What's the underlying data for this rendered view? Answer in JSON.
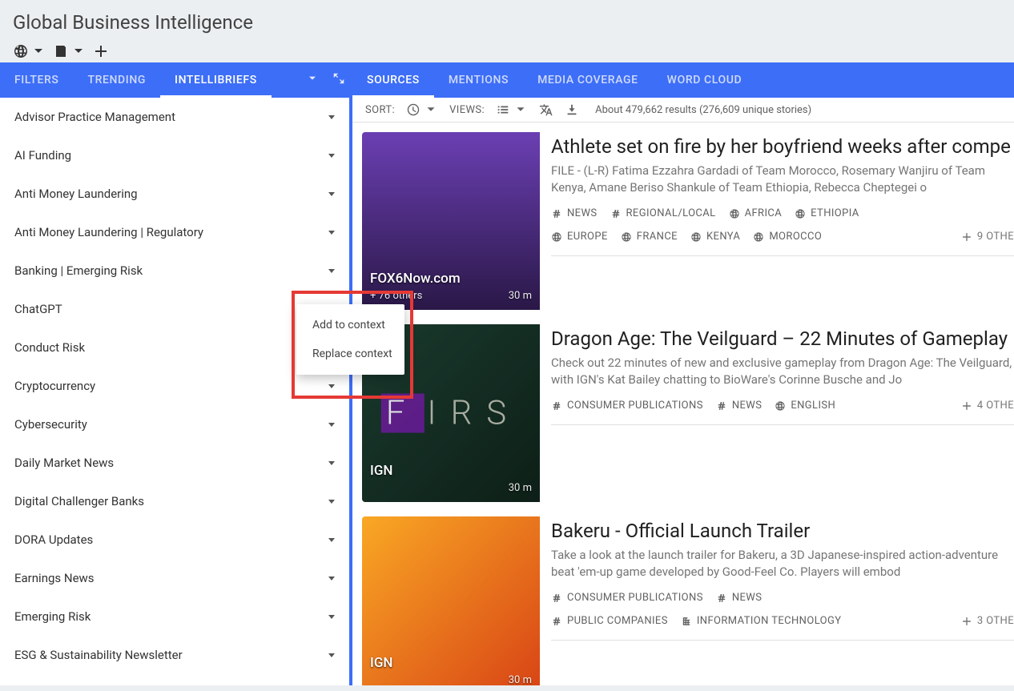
{
  "header": {
    "title": "Global Business Intelligence"
  },
  "left": {
    "tabs": [
      "FILTERS",
      "TRENDING",
      "INTELLIBRIEFS"
    ],
    "active": 2,
    "briefs": [
      "Advisor Practice Management",
      "AI Funding",
      "Anti Money Laundering",
      "Anti Money Laundering | Regulatory",
      "Banking | Emerging Risk",
      "ChatGPT",
      "Conduct Risk",
      "Cryptocurrency",
      "Cybersecurity",
      "Daily Market News",
      "Digital Challenger Banks",
      "DORA Updates",
      "Earnings News",
      "Emerging Risk",
      "ESG & Sustainability Newsletter"
    ],
    "context_menu": {
      "add": "Add to context",
      "replace": "Replace context"
    }
  },
  "right": {
    "tabs": [
      "SOURCES",
      "MENTIONS",
      "MEDIA COVERAGE",
      "WORD CLOUD"
    ],
    "active": 0,
    "toolbar": {
      "sort": "SORT:",
      "views": "VIEWS:",
      "results": "About 479,662 results (276,609 unique stories)"
    },
    "cards": [
      {
        "title": "Athlete set on fire by her boyfriend weeks after compe",
        "desc": "FILE - (L-R) Fatima Ezzahra Gardadi of Team Morocco, Rosemary Wanjiru of Team Kenya, Amane Beriso Shankule of Team Ethiopia, Rebecca Cheptegei o",
        "source": "FOX6Now.com",
        "others": "+ 76 others",
        "time": "30 m",
        "tags1": [
          {
            "i": "hash",
            "t": "NEWS"
          },
          {
            "i": "hash",
            "t": "REGIONAL/LOCAL"
          },
          {
            "i": "globe",
            "t": "AFRICA"
          },
          {
            "i": "globe",
            "t": "ETHIOPIA"
          }
        ],
        "tags2": [
          {
            "i": "globe",
            "t": "EUROPE"
          },
          {
            "i": "globe",
            "t": "FRANCE"
          },
          {
            "i": "globe",
            "t": "KENYA"
          },
          {
            "i": "globe",
            "t": "MOROCCO"
          }
        ],
        "more": "9 OTHE"
      },
      {
        "title": "Dragon Age: The Veilguard – 22 Minutes of Gameplay",
        "desc": "Check out 22 minutes of new and exclusive gameplay from Dragon Age: The Veilguard, with IGN's Kat Bailey chatting to BioWare's Corinne Busche and Jo",
        "source": "IGN",
        "others": "",
        "time": "30 m",
        "tags1": [
          {
            "i": "hash",
            "t": "CONSUMER PUBLICATIONS"
          },
          {
            "i": "hash",
            "t": "NEWS"
          },
          {
            "i": "globe",
            "t": "ENGLISH"
          }
        ],
        "tags2": [],
        "more": "4 OTHE"
      },
      {
        "title": "Bakeru - Official Launch Trailer",
        "desc": "Take a look at the launch trailer for Bakeru, a 3D Japanese-inspired action-adventure beat 'em-up game developed by Good-Feel Co. Players will embod",
        "source": "IGN",
        "others": "",
        "time": "30 m",
        "tags1": [
          {
            "i": "hash",
            "t": "CONSUMER PUBLICATIONS"
          },
          {
            "i": "hash",
            "t": "NEWS"
          }
        ],
        "tags2": [
          {
            "i": "hash",
            "t": "PUBLIC COMPANIES"
          },
          {
            "i": "building",
            "t": "INFORMATION TECHNOLOGY"
          }
        ],
        "more": "3 OTHE"
      }
    ]
  }
}
